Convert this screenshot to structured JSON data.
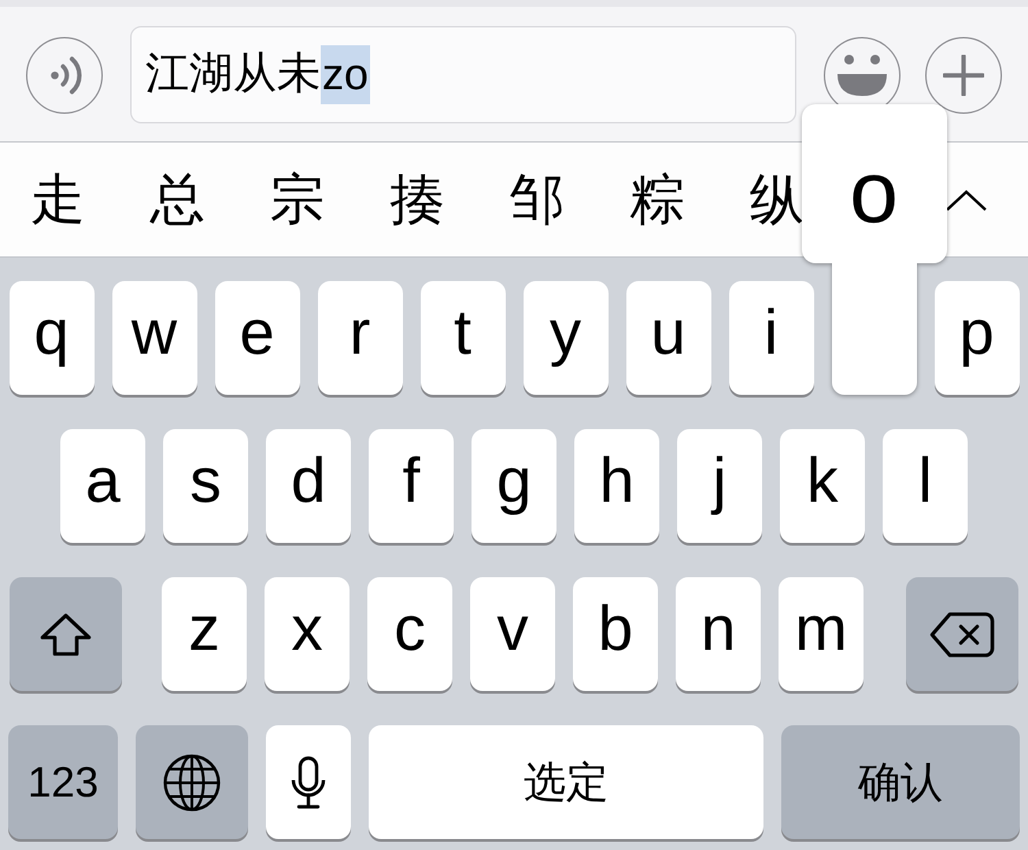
{
  "input_bar": {
    "text": "江湖从未",
    "marked_text": "zo"
  },
  "candidates": {
    "items": [
      "走",
      "总",
      "宗",
      "揍",
      "邹",
      "粽",
      "纵"
    ]
  },
  "keyboard": {
    "rows": [
      {
        "keys": [
          {
            "kind": "letter",
            "label": "q",
            "pressed": false
          },
          {
            "kind": "letter",
            "label": "w",
            "pressed": false
          },
          {
            "kind": "letter",
            "label": "e",
            "pressed": false
          },
          {
            "kind": "letter",
            "label": "r",
            "pressed": false
          },
          {
            "kind": "letter",
            "label": "t",
            "pressed": false
          },
          {
            "kind": "letter",
            "label": "y",
            "pressed": false
          },
          {
            "kind": "letter",
            "label": "u",
            "pressed": false
          },
          {
            "kind": "letter",
            "label": "i",
            "pressed": false
          },
          {
            "kind": "letter",
            "label": "o",
            "pressed": true
          },
          {
            "kind": "letter",
            "label": "p",
            "pressed": false
          }
        ]
      },
      {
        "keys": [
          {
            "kind": "letter",
            "label": "a",
            "pressed": false
          },
          {
            "kind": "letter",
            "label": "s",
            "pressed": false
          },
          {
            "kind": "letter",
            "label": "d",
            "pressed": false
          },
          {
            "kind": "letter",
            "label": "f",
            "pressed": false
          },
          {
            "kind": "letter",
            "label": "g",
            "pressed": false
          },
          {
            "kind": "letter",
            "label": "h",
            "pressed": false
          },
          {
            "kind": "letter",
            "label": "j",
            "pressed": false
          },
          {
            "kind": "letter",
            "label": "k",
            "pressed": false
          },
          {
            "kind": "letter",
            "label": "l",
            "pressed": false
          }
        ]
      },
      {
        "keys": [
          {
            "kind": "shift",
            "pressed": false
          },
          {
            "kind": "letter",
            "label": "z",
            "pressed": false
          },
          {
            "kind": "letter",
            "label": "x",
            "pressed": false
          },
          {
            "kind": "letter",
            "label": "c",
            "pressed": false
          },
          {
            "kind": "letter",
            "label": "v",
            "pressed": false
          },
          {
            "kind": "letter",
            "label": "b",
            "pressed": false
          },
          {
            "kind": "letter",
            "label": "n",
            "pressed": false
          },
          {
            "kind": "letter",
            "label": "m",
            "pressed": false
          },
          {
            "kind": "delete",
            "pressed": false
          }
        ]
      },
      {
        "keys": [
          {
            "kind": "numbers",
            "label": "123",
            "pressed": false
          },
          {
            "kind": "globe",
            "pressed": false
          },
          {
            "kind": "mic",
            "pressed": false
          },
          {
            "kind": "space",
            "label": "选定",
            "pressed": false
          },
          {
            "kind": "return",
            "label": "确认",
            "pressed": false
          }
        ]
      }
    ]
  }
}
